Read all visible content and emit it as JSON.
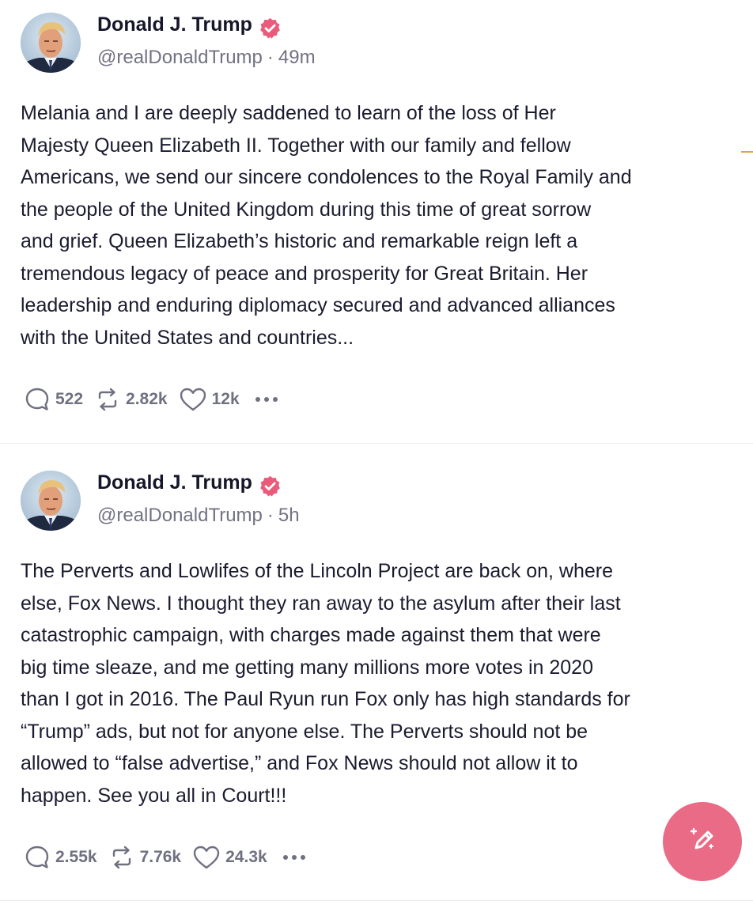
{
  "posts": [
    {
      "author": {
        "name": "Donald J. Trump",
        "handle": "@realDonaldTrump",
        "verified": true
      },
      "time": "49m",
      "text": "Melania and I are deeply saddened to learn of the loss of Her\nMajesty Queen Elizabeth II. Together with our family and fellow\nAmericans, we send our sincere condolences to the Royal Family and\nthe people of the United Kingdom during this time of great sorrow\nand grief. Queen Elizabeth’s historic and remarkable reign left a\ntremendous legacy of peace and prosperity for Great Britain. Her\nleadership and enduring diplomacy secured and advanced alliances\nwith the United States and countries...",
      "stats": {
        "replies": "522",
        "retruths": "2.82k",
        "likes": "12k"
      }
    },
    {
      "author": {
        "name": "Donald J. Trump",
        "handle": "@realDonaldTrump",
        "verified": true
      },
      "time": "5h",
      "text": "The Perverts and Lowlifes of the Lincoln Project are back on, where\nelse, Fox News. I thought they ran away to the asylum after their last\ncatastrophic campaign, with charges made against them that were\nbig time sleaze, and me getting many millions more votes in 2020\nthan I got in 2016. The Paul Ryun run Fox only has high standards for\n“Trump” ads, but not for anyone else. The Perverts should not be\nallowed to “false advertise,” and Fox News should not allow it to\nhappen. See you all in Court!!!",
      "stats": {
        "replies": "2.55k",
        "retruths": "7.76k",
        "likes": "24.3k"
      }
    }
  ],
  "meta_separator": "·",
  "icons": {
    "reply": "reply-icon",
    "retruth": "retruth-icon",
    "like": "heart-icon",
    "more": "more-options-icon",
    "verified": "verified-badge-icon",
    "compose": "compose-icon"
  },
  "colors": {
    "verified_badge": "#ea5a7a",
    "compose_button": "#ea6b85",
    "muted_text": "#727284",
    "body_text": "#1b1b2f"
  }
}
